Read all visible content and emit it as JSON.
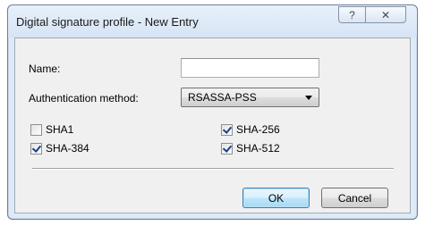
{
  "window": {
    "title": "Digital signature profile - New Entry",
    "help_icon": "help-question-icon",
    "close_icon": "close-icon",
    "help_glyph": "?",
    "close_glyph": "✕"
  },
  "form": {
    "name_label": "Name:",
    "name_value": "",
    "auth_label": "Authentication method:",
    "auth_value": "RSASSA-PSS"
  },
  "hashes": [
    {
      "label": "SHA1",
      "checked": false
    },
    {
      "label": "SHA-256",
      "checked": true
    },
    {
      "label": "SHA-384",
      "checked": true
    },
    {
      "label": "SHA-512",
      "checked": true
    }
  ],
  "buttons": {
    "ok": "OK",
    "cancel": "Cancel"
  },
  "colors": {
    "default_button_border": "#3c7fb1",
    "checkmark": "#1c3f8c"
  }
}
